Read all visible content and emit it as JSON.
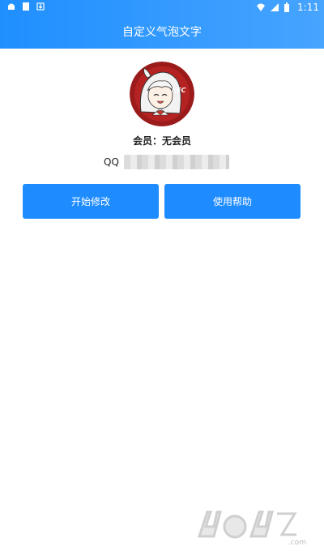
{
  "status_bar": {
    "time": "1:11",
    "left_icons": [
      "notification-icon",
      "sim-card-icon",
      "download-icon"
    ],
    "right_icons": [
      "wifi-icon",
      "signal-icon",
      "battery-icon"
    ]
  },
  "header": {
    "title": "自定义气泡文字",
    "bg_color": "#3396ff"
  },
  "profile": {
    "avatar_text": "KFC",
    "member_label": "会员：无会员",
    "qq_label": "QQ",
    "qq_value": ""
  },
  "actions": {
    "start_label": "开始修改",
    "help_label": "使用帮助",
    "button_color": "#1e8cff"
  },
  "watermark": {
    "text": "4U4Z.com"
  }
}
